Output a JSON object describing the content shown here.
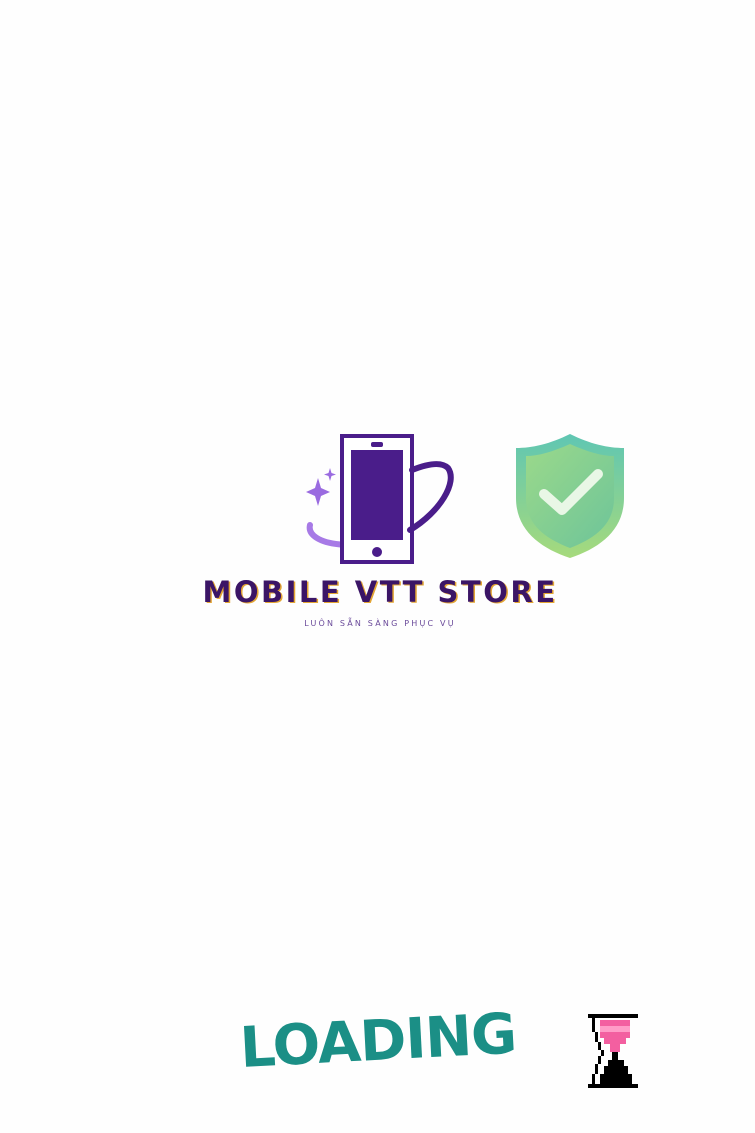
{
  "brand": {
    "name": "MOBILE VTT STORE",
    "tagline": "LUÔN SẴN SÀNG PHỤC VỤ",
    "colors": {
      "primary": "#4a1d8a",
      "accent_orange": "#e3a534",
      "shield_green": "#7ed3a0",
      "shield_teal": "#4fb7b0"
    },
    "icons": {
      "phone": "smartphone-orbit-icon",
      "sparkle": "sparkle-icon",
      "shield": "shield-check-icon"
    }
  },
  "loading": {
    "label": "LOADING",
    "color": "#1b8f86",
    "icon": "hourglass-icon",
    "hourglass_color": "#f35fa0"
  }
}
